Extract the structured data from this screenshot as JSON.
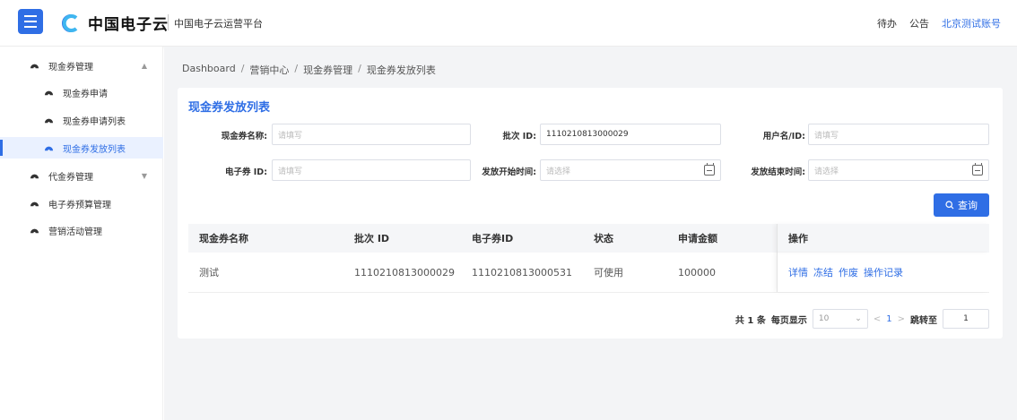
{
  "header": {
    "logo_text": "中国电子云",
    "platform": "中国电子云运营平台",
    "todo": "待办",
    "notice": "公告",
    "account": "北京测试账号",
    "brand_color": "#2f6ee5"
  },
  "sidebar": {
    "items": [
      {
        "label": "现金券管理",
        "arrow": "▲"
      },
      {
        "label": "现金券申请"
      },
      {
        "label": "现金券申请列表"
      },
      {
        "label": "现金券发放列表",
        "active": true
      },
      {
        "label": "代金券管理",
        "arrow": "▼"
      },
      {
        "label": "电子券预算管理"
      },
      {
        "label": "营销活动管理"
      }
    ]
  },
  "breadcrumb": [
    "Dashboard",
    "营销中心",
    "现金券管理",
    "现金券发放列表"
  ],
  "breadcrumb_sep": "/",
  "card": {
    "title": "现金券发放列表"
  },
  "filters": {
    "name_label": "现金券名称:",
    "name_placeholder": "请填写",
    "batch_label": "批次 ID:",
    "batch_value": "1110210813000029",
    "user_label": "用户名/ID:",
    "user_placeholder": "请填写",
    "ecoupon_label": "电子券 ID:",
    "ecoupon_placeholder": "请填写",
    "start_label": "发放开始时间:",
    "start_placeholder": "请选择",
    "end_label": "发放结束时间:",
    "end_placeholder": "请选择",
    "query_button": "查询"
  },
  "table": {
    "columns": [
      "现金券名称",
      "批次 ID",
      "电子券ID",
      "状态",
      "申请金额",
      "操作"
    ],
    "rows": [
      {
        "name": "测试",
        "batch": "1110210813000029",
        "ecoupon": "1110210813000531",
        "status": "可使用",
        "amount": "100000",
        "actions": [
          "详情",
          "冻结",
          "作废",
          "操作记录"
        ]
      }
    ]
  },
  "pagination": {
    "total": "共 1 条",
    "per_page_label": "每页显示",
    "per_page": "10",
    "prev": "<",
    "page": "1",
    "next": ">",
    "jump_label": "跳转至",
    "jump_value": "1"
  }
}
